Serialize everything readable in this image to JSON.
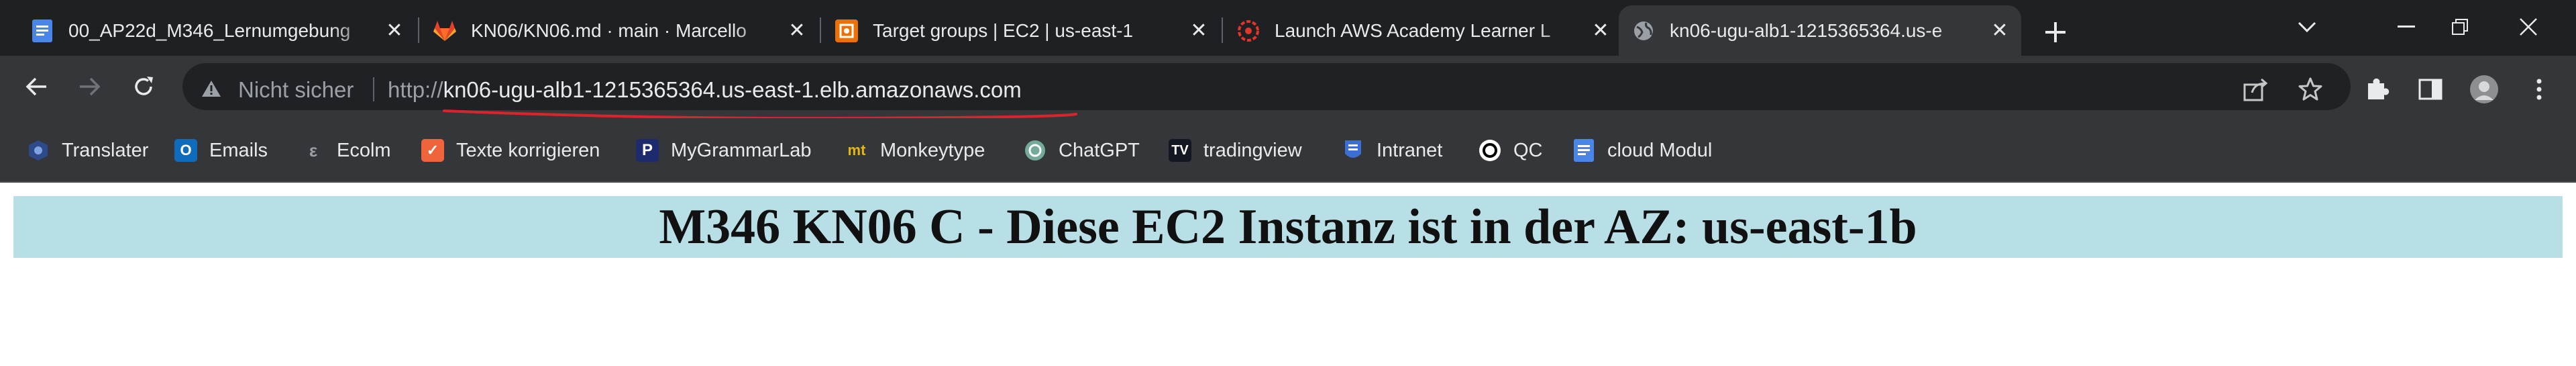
{
  "tabs": [
    {
      "title": "00_AP22d_M346_Lernumgebung",
      "icon": "google-docs-icon",
      "active": false
    },
    {
      "title": "KN06/KN06.md · main · Marcello",
      "icon": "gitlab-icon",
      "active": false
    },
    {
      "title": "Target groups | EC2 | us-east-1",
      "icon": "aws-ec2-icon",
      "active": false
    },
    {
      "title": "Launch AWS Academy Learner L",
      "icon": "aws-academy-icon",
      "active": false
    },
    {
      "title": "kn06-ugu-alb1-1215365364.us-e",
      "icon": "globe-icon",
      "active": true
    }
  ],
  "omnibox": {
    "security_label": "Nicht sicher",
    "url_scheme": "http://",
    "url_host": "kn06-ugu-alb1-1215365364.us-east-1.elb.amazonaws.com"
  },
  "bookmarks": [
    {
      "label": "Translater",
      "icon": "translater-icon"
    },
    {
      "label": "Emails",
      "icon": "outlook-icon"
    },
    {
      "label": "Ecolm",
      "icon": "ecolm-icon"
    },
    {
      "label": "Texte korrigieren",
      "icon": "text-correct-icon"
    },
    {
      "label": "MyGrammarLab",
      "icon": "mygrammarlab-icon"
    },
    {
      "label": "Monkeytype",
      "icon": "monkeytype-icon"
    },
    {
      "label": "ChatGPT",
      "icon": "chatgpt-icon"
    },
    {
      "label": "tradingview",
      "icon": "tradingview-icon"
    },
    {
      "label": "Intranet",
      "icon": "intranet-icon"
    },
    {
      "label": "QC",
      "icon": "qc-icon"
    },
    {
      "label": "cloud Modul",
      "icon": "google-docs-icon"
    }
  ],
  "page": {
    "heading": "M346 KN06 C - Diese EC2 Instanz ist in der AZ: us-east-1b"
  },
  "colors": {
    "tabstrip_bg": "#1f2023",
    "toolbar_bg": "#35363a",
    "omnibox_bg": "#202124",
    "heading_bg": "#b9dfe6",
    "annotation_red": "#d6262b"
  }
}
